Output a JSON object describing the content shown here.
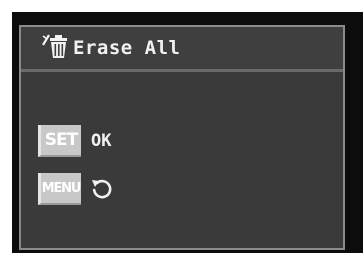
{
  "dialog": {
    "title": "Erase All",
    "title_icon": "erase-trash-icon"
  },
  "options": {
    "set_key": "SET",
    "set_action": "OK",
    "menu_key": "MENU",
    "menu_action_icon": "return-arrow-icon"
  },
  "colors": {
    "screen_bg": "#3a3a3a",
    "key_bg": "#c8c8c8",
    "text": "#f2f2f2"
  }
}
